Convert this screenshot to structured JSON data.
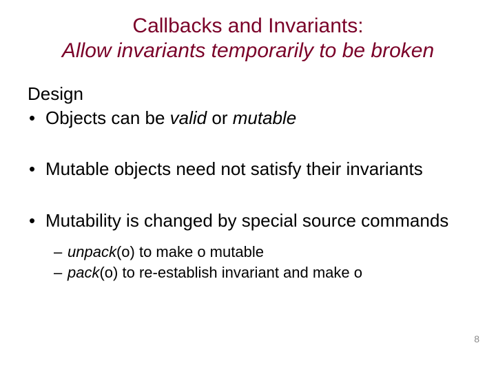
{
  "title": {
    "line1": "Callbacks and Invariants:",
    "line2": "Allow invariants temporarily to be broken"
  },
  "design_label": "Design",
  "bullets": {
    "b1_pre": "Objects can be ",
    "b1_valid": "valid",
    "b1_mid": " or ",
    "b1_mutable": "mutable",
    "b2": "Mutable objects need not satisfy their invariants",
    "b3": "Mutability is changed by special source commands"
  },
  "sub": {
    "s1_cmd": "unpack",
    "s1_rest": "(o) to make o mutable",
    "s2_cmd": "pack",
    "s2_rest": "(o) to re-establish invariant and make o"
  },
  "pagenum": "8"
}
